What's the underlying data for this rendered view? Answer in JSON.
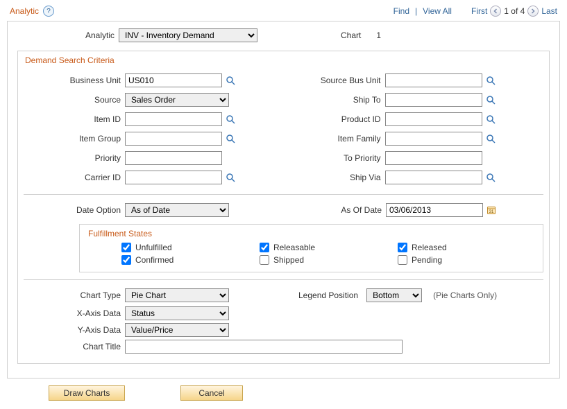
{
  "header": {
    "title": "Analytic",
    "help_tooltip": "?",
    "find": "Find",
    "view_all": "View All",
    "first": "First",
    "counter": "1 of 4",
    "last": "Last"
  },
  "analytic": {
    "label": "Analytic",
    "value": "INV - Inventory Demand",
    "chart_label": "Chart",
    "chart_number": "1"
  },
  "criteria": {
    "title": "Demand Search Criteria",
    "business_unit": {
      "label": "Business Unit",
      "value": "US010"
    },
    "source": {
      "label": "Source",
      "value": "Sales Order"
    },
    "item_id": {
      "label": "Item ID",
      "value": ""
    },
    "item_group": {
      "label": "Item Group",
      "value": ""
    },
    "priority": {
      "label": "Priority",
      "value": ""
    },
    "carrier_id": {
      "label": "Carrier ID",
      "value": ""
    },
    "source_bus_unit": {
      "label": "Source Bus Unit",
      "value": ""
    },
    "ship_to": {
      "label": "Ship To",
      "value": ""
    },
    "product_id": {
      "label": "Product ID",
      "value": ""
    },
    "item_family": {
      "label": "Item Family",
      "value": ""
    },
    "to_priority": {
      "label": "To Priority",
      "value": ""
    },
    "ship_via": {
      "label": "Ship Via",
      "value": ""
    },
    "date_option": {
      "label": "Date Option",
      "value": "As of Date"
    },
    "as_of_date": {
      "label": "As Of Date",
      "value": "03/06/2013"
    }
  },
  "fulfillment": {
    "title": "Fulfillment States",
    "unfulfilled": {
      "label": "Unfulfilled",
      "checked": true
    },
    "releasable": {
      "label": "Releasable",
      "checked": true
    },
    "released": {
      "label": "Released",
      "checked": true
    },
    "confirmed": {
      "label": "Confirmed",
      "checked": true
    },
    "shipped": {
      "label": "Shipped",
      "checked": false
    },
    "pending": {
      "label": "Pending",
      "checked": false
    }
  },
  "chart": {
    "chart_type": {
      "label": "Chart Type",
      "value": "Pie Chart"
    },
    "legend_position": {
      "label": "Legend Position",
      "value": "Bottom"
    },
    "legend_hint": "(Pie Charts Only)",
    "x_axis": {
      "label": "X-Axis Data",
      "value": "Status"
    },
    "y_axis": {
      "label": "Y-Axis Data",
      "value": "Value/Price"
    },
    "title": {
      "label": "Chart Title",
      "value": ""
    }
  },
  "buttons": {
    "draw": "Draw Charts",
    "cancel": "Cancel"
  }
}
